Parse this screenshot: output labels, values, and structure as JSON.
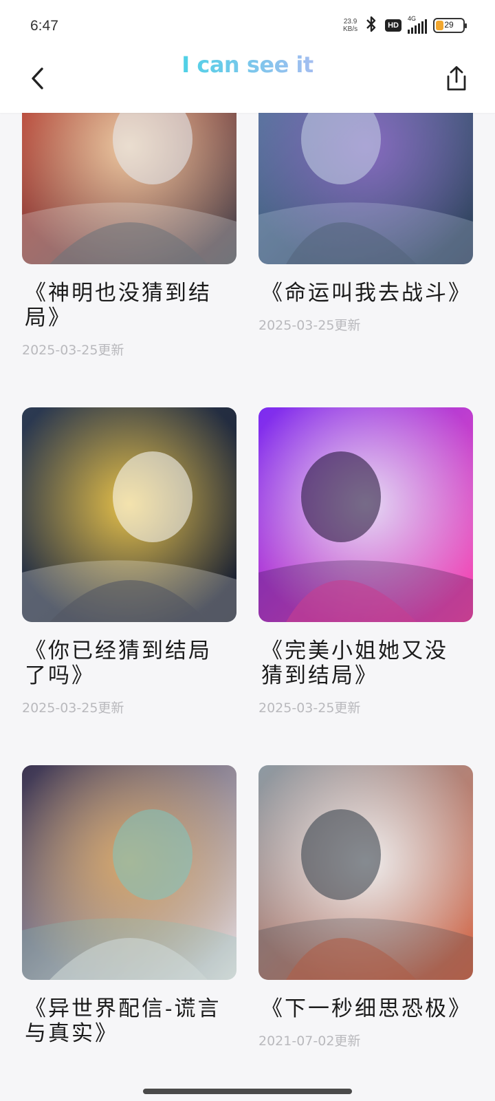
{
  "status_bar": {
    "time": "6:47",
    "net_speed_value": "23.9",
    "net_speed_unit": "KB/s",
    "bluetooth_icon": "bluetooth-icon",
    "hd_label": "HD",
    "network_label": "4G",
    "battery_level": "29",
    "battery_fraction": 0.29,
    "battery_color": "#f2a72f"
  },
  "header": {
    "title": "I can see it",
    "title_gradient": [
      "#4fd1e6",
      "#a3bdf0"
    ],
    "back_icon": "chevron-left-icon",
    "share_icon": "share-icon"
  },
  "comics": [
    {
      "title": "《神明也没猜到结局》",
      "date": "2025-03-25更新",
      "cover_palette": [
        "#c73b2c",
        "#f2d0a6",
        "#e8eef5",
        "#4a4b52"
      ]
    },
    {
      "title": "《命运叫我去战斗》",
      "date": "2025-03-25更新",
      "cover_palette": [
        "#5b7fa6",
        "#8a6bc2",
        "#c9d6e8",
        "#2e3f5a"
      ]
    },
    {
      "title": "《你已经猜到结局了吗》",
      "date": "2025-03-25更新",
      "cover_palette": [
        "#2c3a52",
        "#f0c84a",
        "#ffffff",
        "#1a1f2e"
      ]
    },
    {
      "title": "《完美小姐她又没猜到结局》",
      "date": "2025-03-25更新",
      "cover_palette": [
        "#7b2cf0",
        "#e8e2f5",
        "#1c1030",
        "#ff4fb0"
      ]
    },
    {
      "title": "《异世界配信-谎言与真实》",
      "date": "",
      "cover_palette": [
        "#3a3350",
        "#d8a86a",
        "#7ec7c0",
        "#e9dede"
      ]
    },
    {
      "title": "《下一秒细思恐极》",
      "date": "2021-07-02更新",
      "cover_palette": [
        "#8d9aa3",
        "#f2f2f2",
        "#2f3a46",
        "#d96a4a"
      ]
    }
  ]
}
